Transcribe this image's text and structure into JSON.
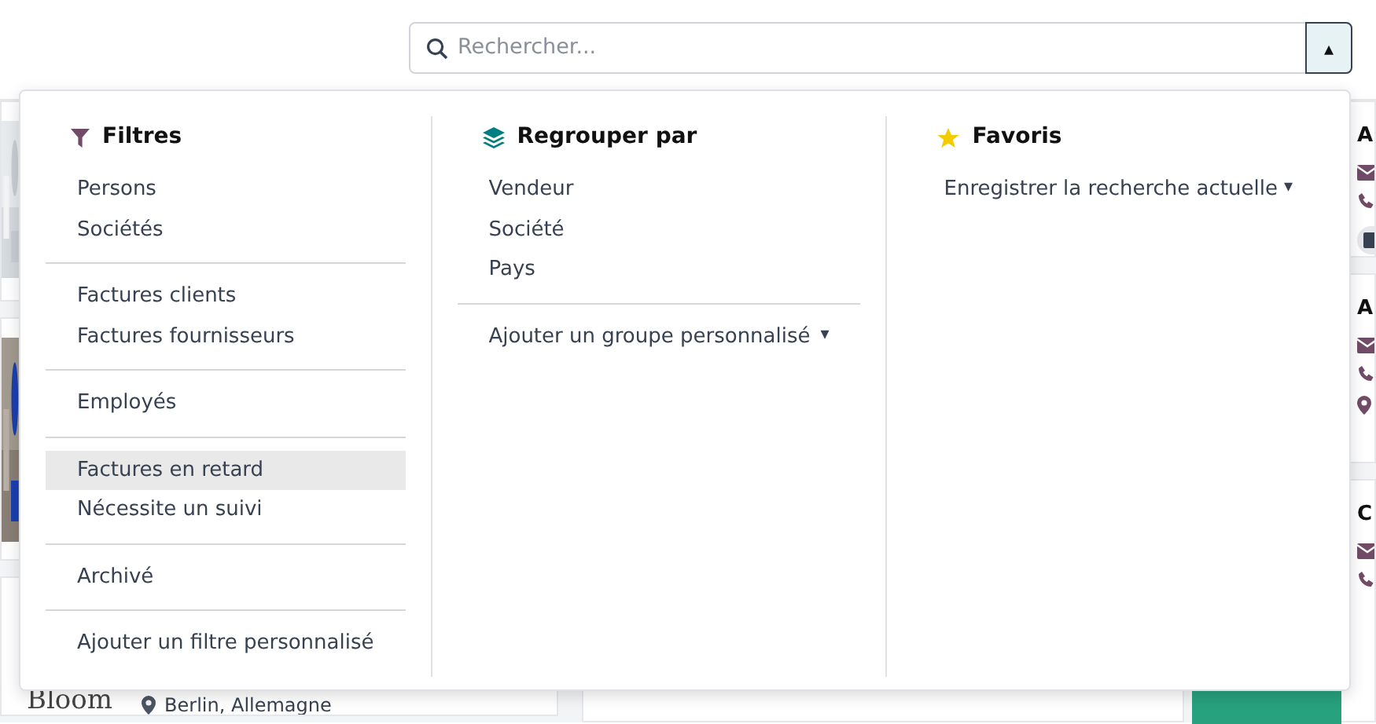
{
  "search": {
    "placeholder": "Rechercher...",
    "toggle": "▴",
    "expanded": true
  },
  "panels": [
    {
      "kind": "filters",
      "title": "Filtres",
      "groups": [
        [
          {
            "label": "Persons",
            "selected": false
          },
          {
            "label": "Sociétés",
            "selected": false
          }
        ],
        [
          {
            "label": "Factures clients",
            "selected": false
          },
          {
            "label": "Factures fournisseurs",
            "selected": false
          }
        ],
        [
          {
            "label": "Employés",
            "selected": false
          }
        ],
        [
          {
            "label": "Factures en retard",
            "selected": true
          },
          {
            "label": "Nécessite un suivi",
            "selected": false
          }
        ],
        [
          {
            "label": "Archivé",
            "selected": false
          }
        ],
        [
          {
            "label": "Ajouter un filtre personnalisé",
            "selected": false
          }
        ]
      ]
    },
    {
      "kind": "groupby",
      "title": "Regrouper par",
      "groups": [
        [
          {
            "label": "Vendeur",
            "selected": false
          },
          {
            "label": "Société",
            "selected": false
          },
          {
            "label": "Pays",
            "selected": false
          }
        ],
        [
          {
            "label": "Ajouter un groupe personnalisé",
            "selected": false,
            "caret": "▾"
          }
        ]
      ]
    },
    {
      "kind": "favorites",
      "title": "Favoris",
      "groups": [
        [
          {
            "label": "Enregistrer la recherche actuelle",
            "selected": false,
            "caret": "▾"
          }
        ]
      ]
    }
  ],
  "background_cards": [
    {
      "name": "A",
      "address": false,
      "tag": true
    },
    {
      "name": "A",
      "address": true,
      "tag": false
    },
    {
      "name": "C",
      "address": false,
      "tag": false
    }
  ],
  "bottom_card": {
    "name": "Bloom",
    "location": "Berlin, Allemagne"
  }
}
